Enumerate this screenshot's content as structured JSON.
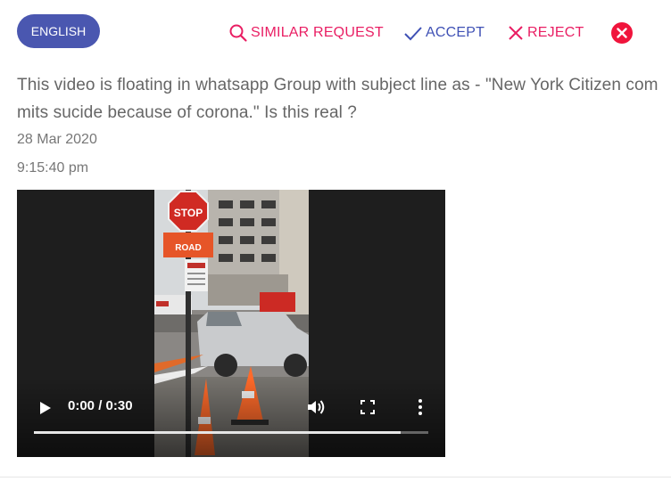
{
  "language_button": "ENGLISH",
  "actions": {
    "similar_request": "SIMILAR REQUEST",
    "accept": "ACCEPT",
    "reject": "REJECT"
  },
  "request": {
    "text": "This video is floating in whatsapp Group with subject line as - \"New York Citizen commits sucide because of corona.\" Is this real ?",
    "date": "28 Mar 2020",
    "time": "9:15:40 pm"
  },
  "video": {
    "current_time": "0:00",
    "duration": "0:30",
    "time_display": "0:00 / 0:30",
    "buffered_fraction": 0.93,
    "stop_sign_text": "STOP",
    "road_sign_text": "ROAD"
  },
  "colors": {
    "primary": "#4a57b0",
    "accent_pink": "#e91e63",
    "accept_blue": "#3f51b5",
    "close_red": "#f0143c"
  },
  "icons": {
    "similar": "search-icon",
    "accept": "check-icon",
    "reject": "close-icon",
    "dismiss": "close-circle-icon"
  }
}
